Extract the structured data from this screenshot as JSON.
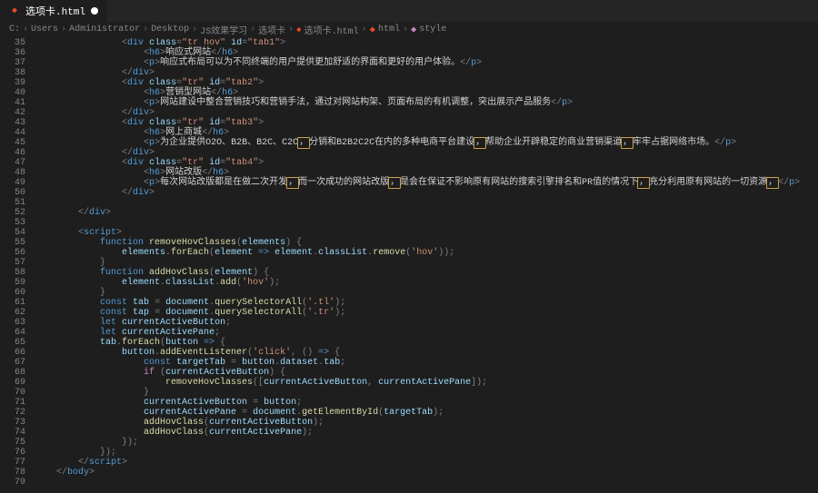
{
  "tab": {
    "filename": "选项卡.html",
    "dirty": true
  },
  "breadcrumbs": {
    "parts": [
      "C:",
      "Users",
      "Administrator",
      "Desktop",
      "JS效果学习",
      "选项卡"
    ],
    "file": "选项卡.html",
    "symbols": [
      "html",
      "style"
    ]
  },
  "gutter": {
    "start": 35,
    "end": 79
  },
  "content": {
    "tab1_id": "tab1",
    "tab1_h6": "响应式网站",
    "tab1_p": "响应式布局可以为不同终端的用户提供更加舒适的界面和更好的用户体验。",
    "tab2_id": "tab2",
    "tab2_h6": "营销型网站",
    "tab2_p": "网站建设中整合营销技巧和营销手法，通过对网站构架、页面布局的有机调整，突出展示产品服务",
    "tab3_id": "tab3",
    "tab3_h6": "网上商城",
    "tab3_p_a": "为企业提供O2O、B2B、B2C、C2C",
    "tab3_p_b": "分销和B2B2C2C在内的多种电商平台建设",
    "tab3_p_c": "帮助企业开辟稳定的商业营销渠道",
    "tab3_p_d": "牢牢占据网络市场。",
    "tab4_id": "tab4",
    "tab4_h6": "网站改版",
    "tab4_p_a": "每次网站改版都是在做二次开发",
    "tab4_p_b": "而一次成功的网站改版",
    "tab4_p_c": "是会在保证不影响原有网站的搜索引擎排名和PR值的情况下",
    "tab4_p_d": "充分利用原有网站的一切资源"
  },
  "js": {
    "fn_remove": "removeHovClasses",
    "fn_add": "addHovClass",
    "param_elements": "elements",
    "param_element": "element",
    "hov": "hov",
    "tab": "tab",
    "tap": "tap",
    "sel_tl": ".tl",
    "sel_tr": ".tr",
    "currentActiveButton": "currentActiveButton",
    "currentActivePane": "currentActivePane",
    "button": "button",
    "click": "click",
    "targetTab": "targetTab"
  }
}
